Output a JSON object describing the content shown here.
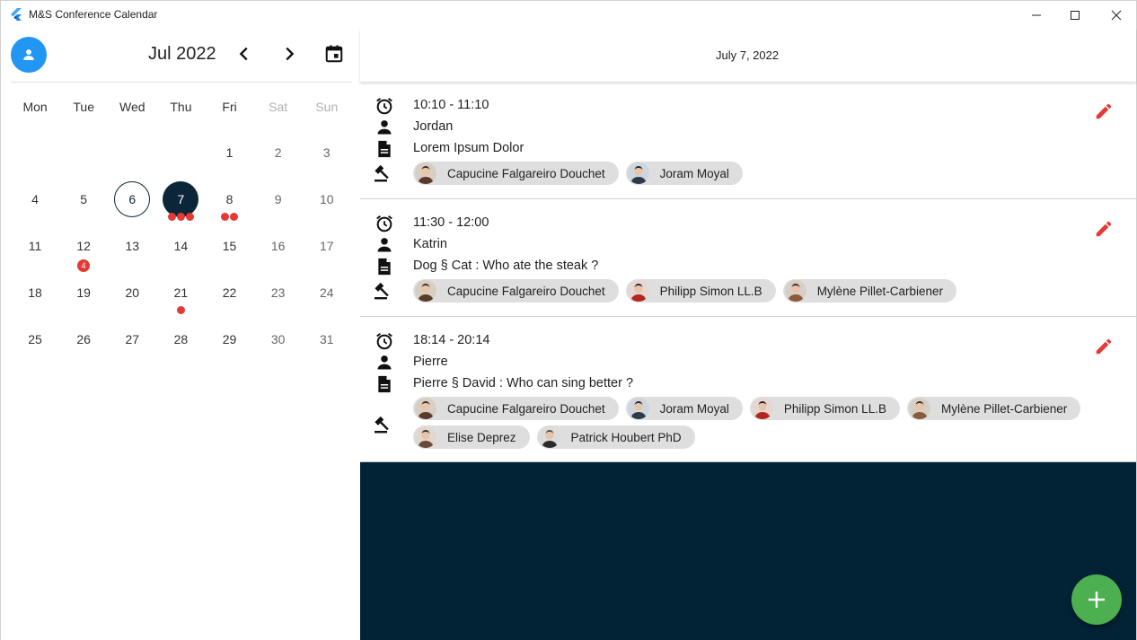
{
  "window": {
    "title": "M&S Conference Calendar",
    "icon": "flutter-logo-icon"
  },
  "calendar": {
    "month_label": "Jul 2022",
    "weekdays": [
      "Mon",
      "Tue",
      "Wed",
      "Thu",
      "Fri",
      "Sat",
      "Sun"
    ],
    "weeks": [
      [
        "",
        "",
        "",
        "",
        "1",
        "2",
        "3"
      ],
      [
        "4",
        "5",
        "6",
        "7",
        "8",
        "9",
        "10"
      ],
      [
        "11",
        "12",
        "13",
        "14",
        "15",
        "16",
        "17"
      ],
      [
        "18",
        "19",
        "20",
        "21",
        "22",
        "23",
        "24"
      ],
      [
        "25",
        "26",
        "27",
        "28",
        "29",
        "30",
        "31"
      ]
    ],
    "today": "6",
    "selected": "7",
    "markers": {
      "7": {
        "dots": 3
      },
      "8": {
        "dots": 2
      },
      "12": {
        "count": "4"
      },
      "21": {
        "dots": 1
      }
    },
    "colors": {
      "selected": "#0a2638",
      "marker": "#e53935",
      "avatar_button": "#2196f3"
    }
  },
  "day_view": {
    "date_label": "July 7, 2022",
    "background": "#022335",
    "events": [
      {
        "time": "10:10 - 11:10",
        "person": "Jordan",
        "title": "Lorem Ipsum Dolor",
        "judges": [
          {
            "name": "Capucine Falgareiro Douchet",
            "avatar": "avatar-f1"
          },
          {
            "name": "Joram Moyal",
            "avatar": "avatar-m1"
          }
        ]
      },
      {
        "time": "11:30 - 12:00",
        "person": "Katrin",
        "title": "Dog § Cat : Who ate the steak ?",
        "judges": [
          {
            "name": "Capucine Falgareiro Douchet",
            "avatar": "avatar-f1"
          },
          {
            "name": "Philipp Simon LL.B",
            "avatar": "avatar-m2"
          },
          {
            "name": "Mylène Pillet-Carbiener",
            "avatar": "avatar-f2"
          }
        ]
      },
      {
        "time": "18:14 - 20:14",
        "person": "Pierre",
        "title": "Pierre § David : Who can sing better ?",
        "judges": [
          {
            "name": "Capucine Falgareiro Douchet",
            "avatar": "avatar-f1"
          },
          {
            "name": "Joram Moyal",
            "avatar": "avatar-m1"
          },
          {
            "name": "Philipp Simon LL.B",
            "avatar": "avatar-m2"
          },
          {
            "name": "Mylène Pillet-Carbiener",
            "avatar": "avatar-f2"
          },
          {
            "name": "Elise Deprez",
            "avatar": "avatar-f3"
          },
          {
            "name": "Patrick Houbert PhD",
            "avatar": "avatar-m3"
          }
        ]
      }
    ],
    "fab_icon": "plus-icon",
    "fab_color": "#4caf50",
    "edit_color": "#e53935"
  }
}
